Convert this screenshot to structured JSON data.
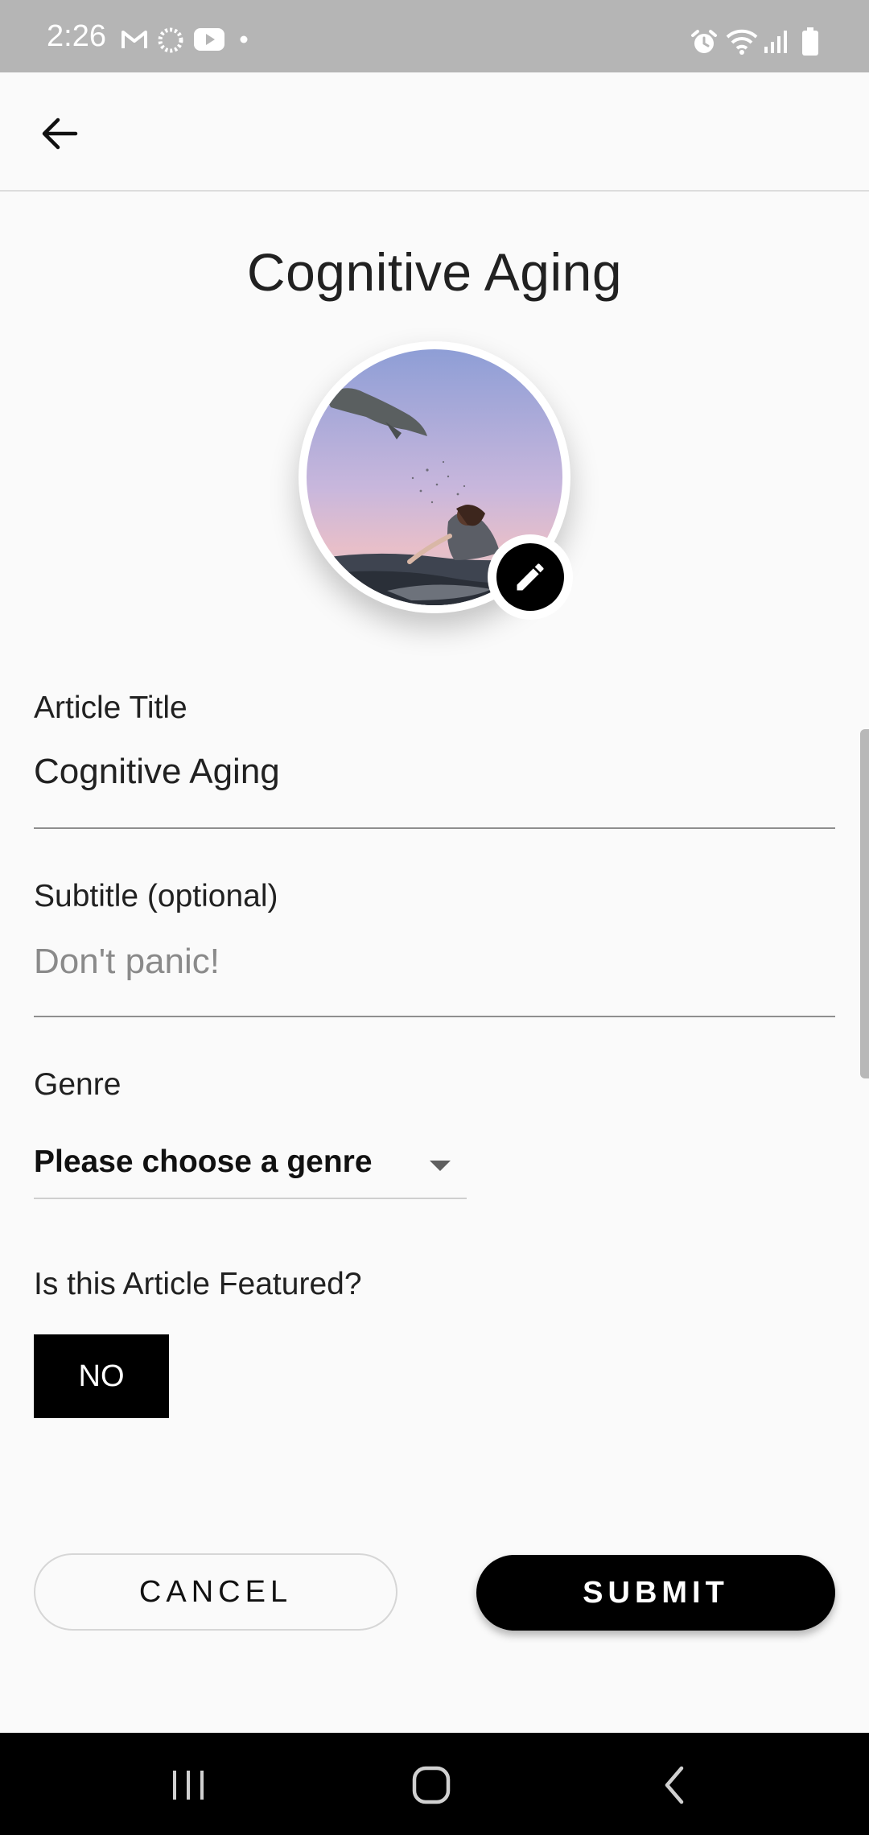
{
  "status_bar": {
    "time": "2:26"
  },
  "app_bar": {
    "back_icon": "arrow-left-icon"
  },
  "page": {
    "title": "Cognitive Aging"
  },
  "form": {
    "title_field": {
      "label": "Article Title",
      "value": "Cognitive Aging"
    },
    "subtitle_field": {
      "label": "Subtitle (optional)",
      "placeholder": "Don't panic!",
      "value": ""
    },
    "genre_field": {
      "label": "Genre",
      "selected": "Please choose a genre"
    },
    "featured": {
      "label": "Is this Article Featured?",
      "toggle_label": "NO"
    }
  },
  "actions": {
    "cancel_label": "CANCEL",
    "submit_label": "SUBMIT"
  },
  "colors": {
    "accent": "#000000",
    "background": "#fafafa",
    "status_bar": "#b5b5b5",
    "nav_bar": "#000000"
  },
  "icons": {
    "edit": "pencil-icon",
    "dropdown": "caret-down-icon",
    "nav_recents": "recents-icon",
    "nav_home": "home-icon",
    "nav_back": "chevron-left-icon"
  }
}
